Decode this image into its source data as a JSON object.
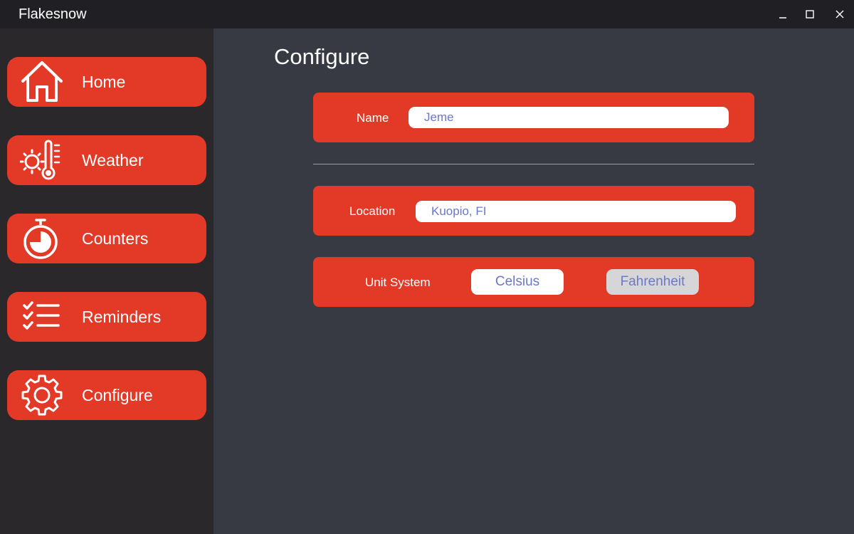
{
  "window": {
    "title": "Flakesnow",
    "controls": [
      "minimize-icon",
      "maximize-icon",
      "close-icon"
    ]
  },
  "sidebar": {
    "items": [
      {
        "label": "Home",
        "icon": "home-icon"
      },
      {
        "label": "Weather",
        "icon": "weather-thermometer-icon"
      },
      {
        "label": "Counters",
        "icon": "stopwatch-icon"
      },
      {
        "label": "Reminders",
        "icon": "checklist-icon"
      },
      {
        "label": "Configure",
        "icon": "gear-icon"
      }
    ]
  },
  "main": {
    "title": "Configure",
    "name": {
      "label": "Name",
      "value": "Jeme"
    },
    "location": {
      "label": "Location",
      "value": "Kuopio, FI"
    },
    "unit_system": {
      "label": "Unit System",
      "options": [
        "Celsius",
        "Fahrenheit"
      ]
    }
  },
  "colors": {
    "accent": "#e33a28",
    "sidebar_bg": "#2a282b",
    "main_bg": "#383a43",
    "titlebar_bg": "#202024",
    "input_text": "#6b78c8"
  }
}
